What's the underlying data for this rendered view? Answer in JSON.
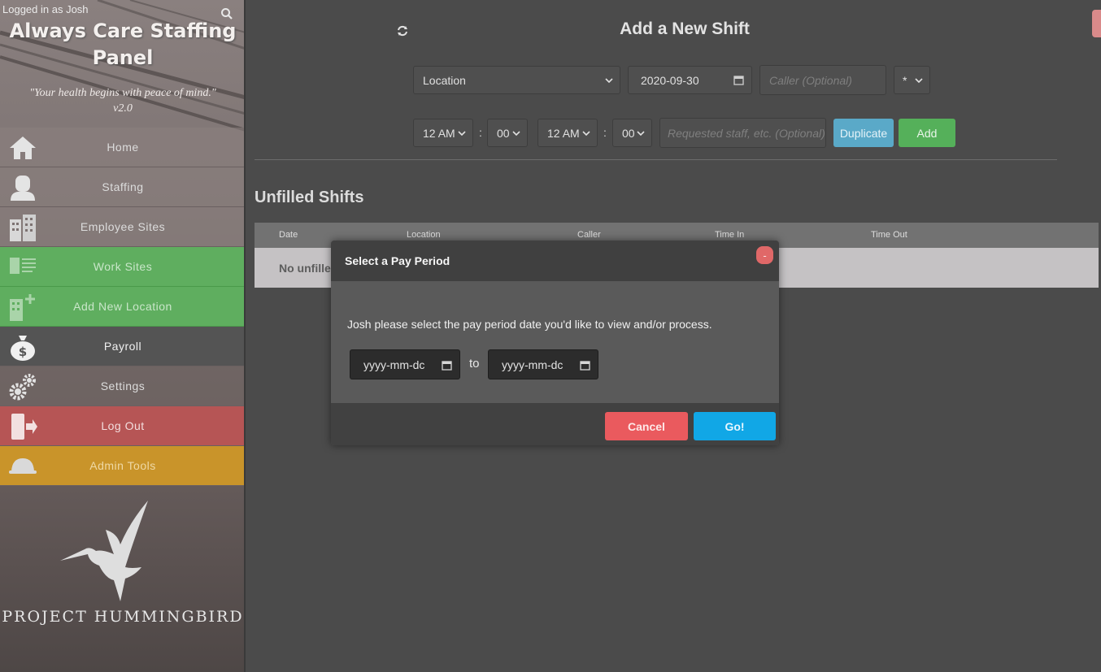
{
  "sidebar": {
    "logged_in": "Logged in as Josh",
    "brand_line1": "Always Care Staffing",
    "brand_line2": "Panel",
    "motto": "\"Your health begins with peace of mind.\"",
    "version": "v2.0",
    "items": [
      {
        "label": "Home",
        "icon": "home-icon"
      },
      {
        "label": "Staffing",
        "icon": "person-icon"
      },
      {
        "label": "Employee Sites",
        "icon": "building-icon"
      },
      {
        "label": "Work Sites",
        "icon": "building-list-icon"
      },
      {
        "label": "Add New Location",
        "icon": "building-add-icon"
      },
      {
        "label": "Payroll",
        "icon": "money-bag-icon"
      },
      {
        "label": "Settings",
        "icon": "gears-icon"
      },
      {
        "label": "Log Out",
        "icon": "exit-door-icon"
      },
      {
        "label": "Admin Tools",
        "icon": "hard-hat-icon"
      }
    ],
    "footer_text": "PROJECT HUMMINGBIRD"
  },
  "main": {
    "title": "Add a New Shift",
    "form": {
      "location": "Location",
      "date": "2020-09-30",
      "caller_placeholder": "Caller (Optional)",
      "star_select": "*",
      "time_in_hour": "12 AM",
      "time_in_min": "00",
      "time_out_hour": "12 AM",
      "time_out_min": "00",
      "colon": ":",
      "notes_placeholder": "Requested staff, etc. (Optional)",
      "duplicate_label": "Duplicate",
      "add_label": "Add"
    },
    "unfilled": {
      "title": "Unfilled Shifts",
      "columns": [
        "Date",
        "Location",
        "Caller",
        "Time In",
        "Time Out"
      ],
      "empty_text": "No unfille"
    }
  },
  "modal": {
    "title": "Select a Pay Period",
    "close_label": "-",
    "message": "Josh please select the pay period date you'd like to view and/or process.",
    "from_placeholder": "yyyy-mm-dd",
    "from_display": "yyyy-mm-dс",
    "to_label": "to",
    "to_display": "yyyy-mm-dс",
    "cancel_label": "Cancel",
    "go_label": "Go!"
  },
  "colors": {
    "accent_green": "#5fae5f",
    "logout_red": "#b65555",
    "admin_gold": "#c9942a",
    "cancel_red": "#ea5a5e",
    "go_blue": "#11a7e6"
  }
}
